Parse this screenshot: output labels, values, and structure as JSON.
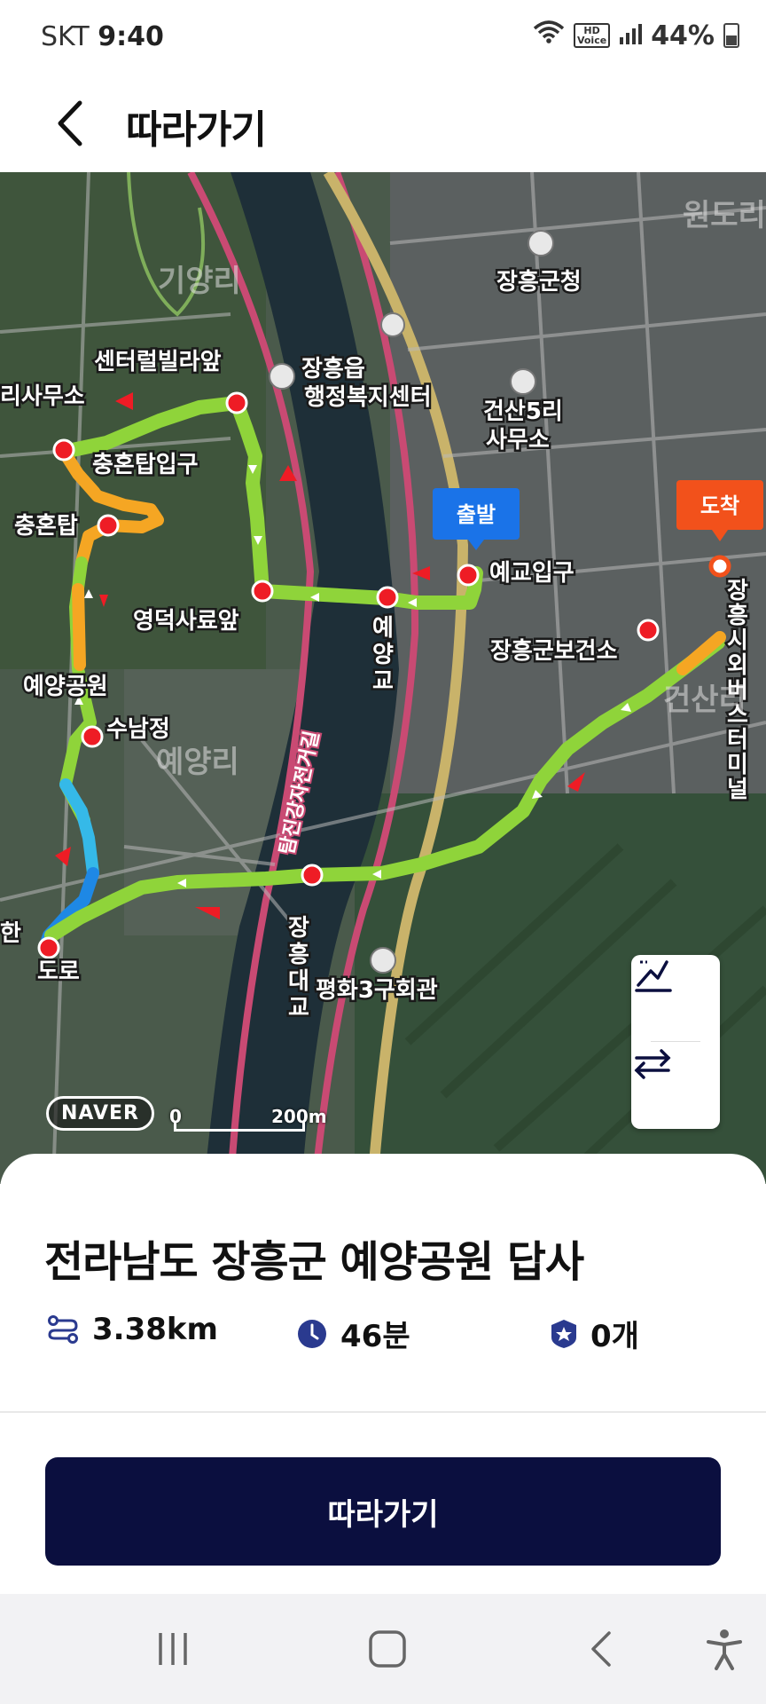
{
  "status_bar": {
    "carrier": "SKT",
    "time": "9:40",
    "hd_line1": "HD",
    "hd_line2": "Voice",
    "battery": "44%"
  },
  "header": {
    "title": "따라가기"
  },
  "map": {
    "pin_start": "출발",
    "pin_end": "도착",
    "place_labels": [
      "장흥군청",
      "장흥읍\n행정복지센터",
      "건산5리\n사무소",
      "센터럴빌라앞",
      "충혼탑입구",
      "충혼탑",
      "영덕사료앞",
      "예교입구",
      "장흥군보건소",
      "예양교",
      "예양공원",
      "수남정",
      "예양리",
      "기양리",
      "탐진강자전거길",
      "장흥대교",
      "평화3구회관",
      "도로",
      "리사무소",
      "장흥시외버스터미널",
      "건산리",
      "원도리",
      "한"
    ],
    "naver_logo": "NAVER",
    "scale_start": "0",
    "scale_end": "200m",
    "colors": {
      "route_green": "#8fd43a",
      "route_orange": "#f5a623",
      "route_blue": "#1e88e5",
      "waypoint_red": "#ee1c25",
      "pin_start_blue": "#1a73e8",
      "pin_end_orange": "#f2511b"
    }
  },
  "map_controls": {
    "elevation_icon": "elevation-chart-icon",
    "swap_icon": "swap-direction-icon"
  },
  "route": {
    "title": "전라남도 장흥군 예양공원 답사",
    "distance": "3.38km",
    "time": "46분",
    "badge_count": "0개"
  },
  "action": {
    "follow_label": "따라가기"
  },
  "nav": {
    "recent_icon": "recent-apps-icon",
    "home_icon": "home-icon",
    "back_icon": "back-icon",
    "accessibility_icon": "accessibility-icon"
  }
}
